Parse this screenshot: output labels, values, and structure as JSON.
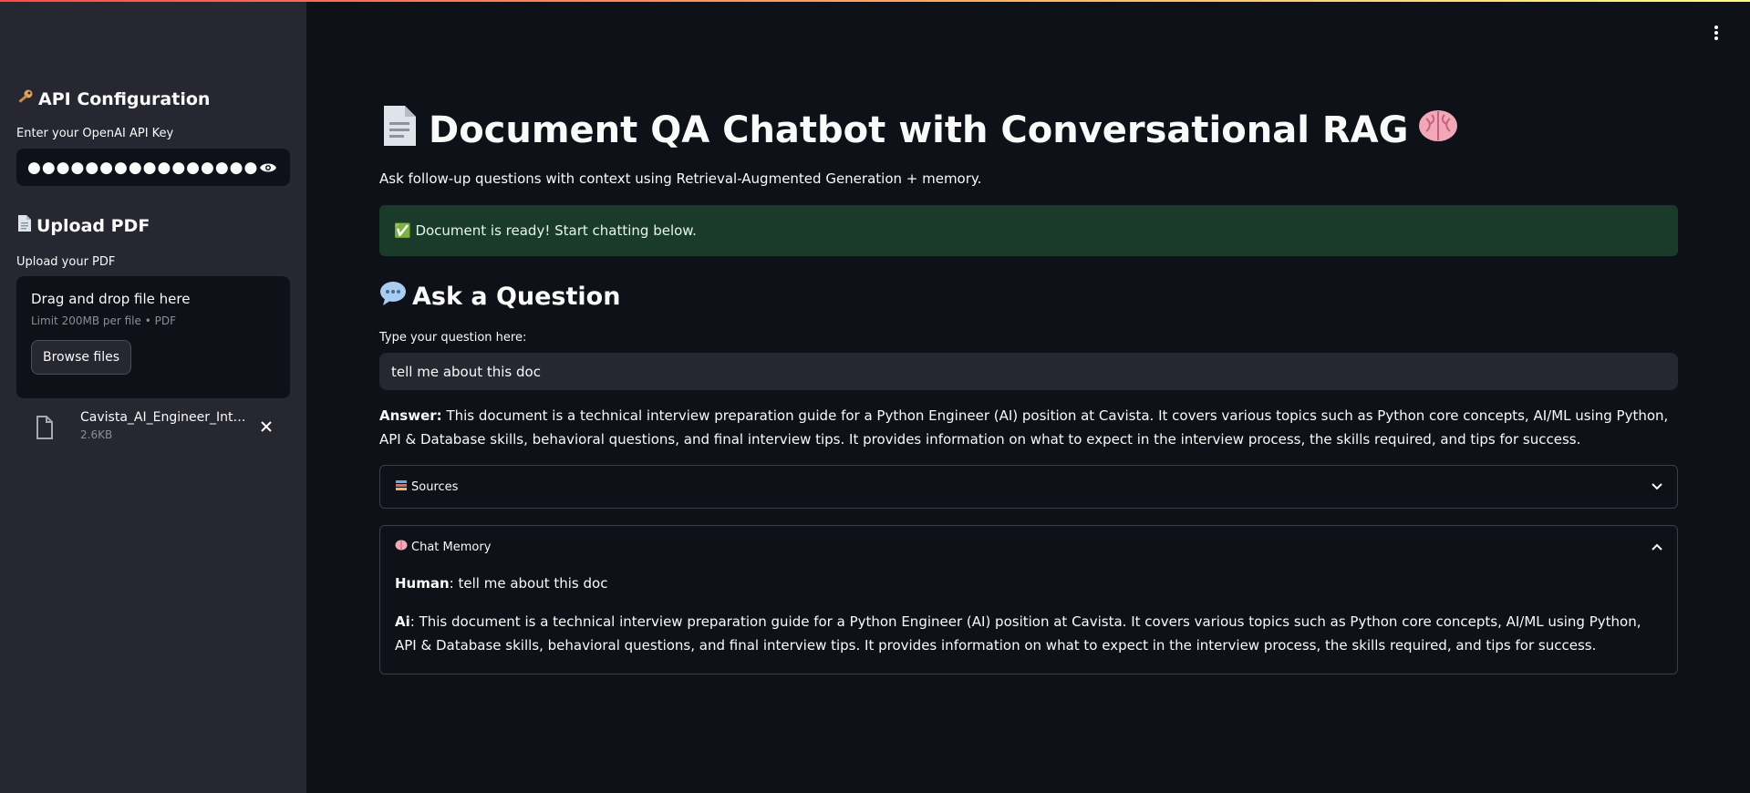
{
  "sidebar": {
    "api_heading": "API Configuration",
    "api_heading_icon": "key-icon",
    "api_label": "Enter your OpenAI API Key",
    "api_value": "●●●●●●●●●●●●●●●●●●",
    "upload_heading": "Upload PDF",
    "upload_heading_icon": "document-icon",
    "upload_label": "Upload your PDF",
    "dropzone_title": "Drag and drop file here",
    "dropzone_sub": "Limit 200MB per file • PDF",
    "browse_label": "Browse files",
    "file_name": "Cavista_AI_Engineer_Interview_Prep.pdf",
    "file_size": "2.6KB"
  },
  "main": {
    "title": "Document QA Chatbot with Conversational RAG",
    "subtitle": "Ask follow-up questions with context using Retrieval-Augmented Generation + memory.",
    "success": "✅ Document is ready! Start chatting below.",
    "ask_heading": "Ask a Question",
    "question_label": "Type your question here:",
    "question_value": "tell me about this doc",
    "answer_label": "Answer:",
    "answer_text": "This document is a technical interview preparation guide for a Python Engineer (AI) position at Cavista. It covers various topics such as Python core concepts, AI/ML using Python, API & Database skills, behavioral questions, and final interview tips. It provides information on what to expect in the interview process, the skills required, and tips for success.",
    "sources_label": "Sources",
    "memory_label": "Chat Memory",
    "memory": [
      {
        "role": "Human",
        "text": ": tell me about this doc"
      },
      {
        "role": "Ai",
        "text": ": This document is a technical interview preparation guide for a Python Engineer (AI) position at Cavista. It covers various topics such as Python core concepts, AI/ML using Python, API & Database skills, behavioral questions, and final interview tips. It provides information on what to expect in the interview process, the skills required, and tips for success."
      }
    ]
  },
  "colors": {
    "background": "#0e1117",
    "sidebar": "#262730",
    "success_bg": "#1a3a2a"
  }
}
